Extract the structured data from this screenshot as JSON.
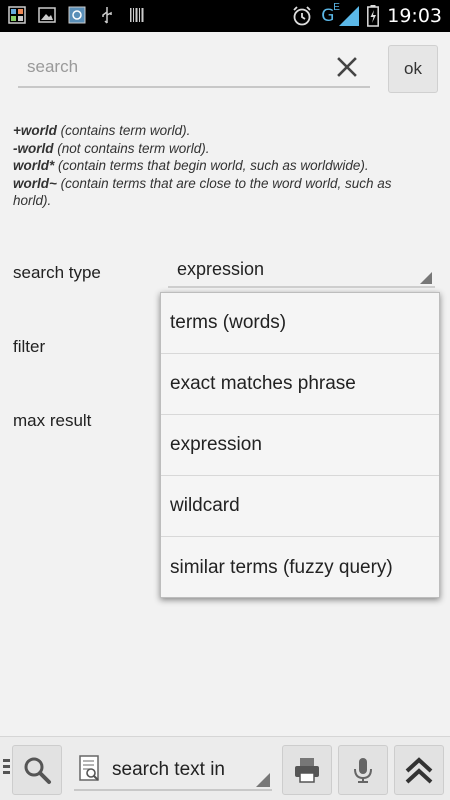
{
  "status_bar": {
    "time": "19:03",
    "network_label": "G",
    "network_sub": "E"
  },
  "search": {
    "placeholder": "search",
    "ok_label": "ok"
  },
  "help": {
    "lines": [
      {
        "term": "+world",
        "desc": " (contains term world)."
      },
      {
        "term": "-world",
        "desc": " (not contains term world)."
      },
      {
        "term": "world*",
        "desc": " (contain terms that begin world, such as worldwide)."
      },
      {
        "term": "world~",
        "desc": " (contain terms that are close to the word world, such as horld)."
      }
    ]
  },
  "form": {
    "search_type_label": "search type",
    "search_type_value": "expression",
    "filter_label": "filter",
    "max_result_label": "max result"
  },
  "dropdown": {
    "options": [
      "terms (words)",
      "exact matches phrase",
      "expression",
      "wildcard",
      "similar terms (fuzzy query)"
    ]
  },
  "toolbar": {
    "search_text_in": "search text in"
  }
}
